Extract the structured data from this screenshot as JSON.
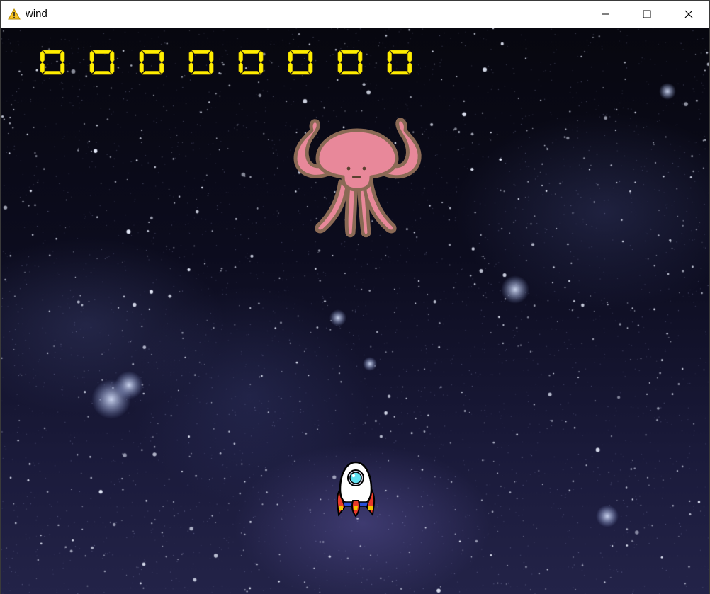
{
  "window": {
    "title": "wind",
    "icon": "warning-icon",
    "controls": [
      "minimize-icon",
      "maximize-icon",
      "close-icon"
    ]
  },
  "game": {
    "score_digits": [
      "0",
      "0",
      "0",
      "0",
      "0",
      "0",
      "0",
      "0"
    ],
    "score_color": "#ffee00",
    "enemy": {
      "type": "pink-jellyfish-alien",
      "color": "#e8889a"
    },
    "player": {
      "type": "white-rocket-ship"
    }
  }
}
